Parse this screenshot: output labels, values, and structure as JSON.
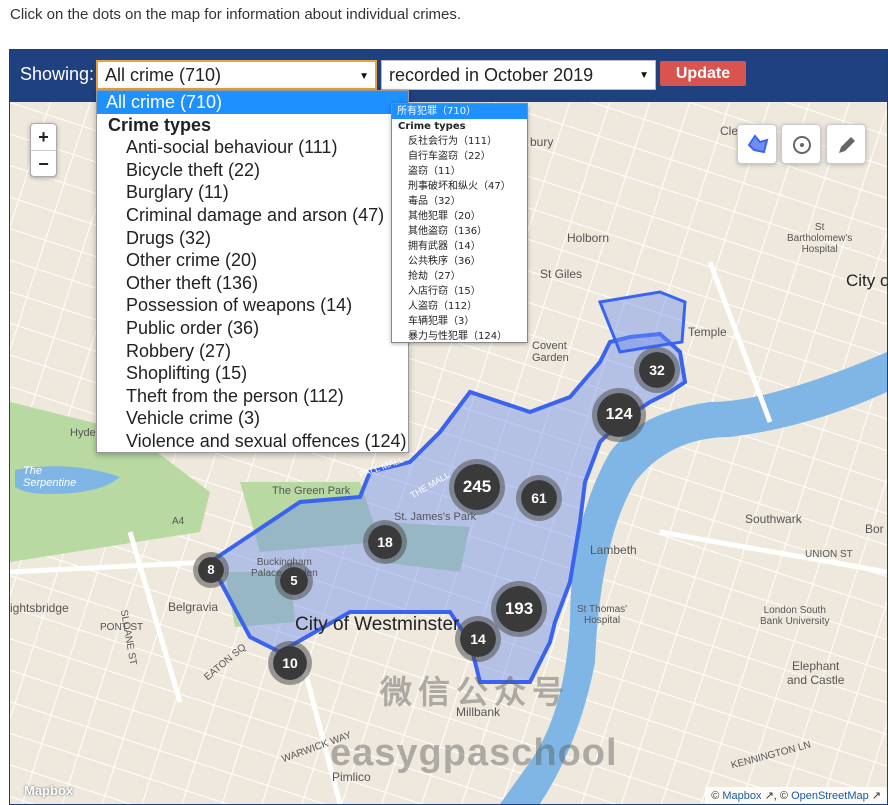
{
  "intro_text": "Click on the dots on the map for information about individual crimes.",
  "toolbar": {
    "showing_label": "Showing:",
    "crime_select_value": "All crime (710)",
    "period_select_value": "recorded in October 2019",
    "update_label": "Update"
  },
  "crime_dropdown": {
    "selected": "All crime (710)",
    "group_label": "Crime types",
    "options": [
      "Anti-social behaviour (111)",
      "Bicycle theft (22)",
      "Burglary (11)",
      "Criminal damage and arson (47)",
      "Drugs (32)",
      "Other crime (20)",
      "Other theft (136)",
      "Possession of weapons (14)",
      "Public order (36)",
      "Robbery (27)",
      "Shoplifting (15)",
      "Theft from the person (112)",
      "Vehicle crime (3)",
      "Violence and sexual offences (124)"
    ]
  },
  "crime_dropdown_zh": {
    "selected": "所有犯罪（710）",
    "group_label": "Crime types",
    "options": [
      "反社会行为（111）",
      "自行车盗窃（22）",
      "盗窃（11）",
      "刑事破坏和纵火（47）",
      "毒品（32）",
      "其他犯罪（20）",
      "其他盗窃（136）",
      "拥有武器（14）",
      "公共秩序（36）",
      "抢劫（27）",
      "入店行窃（15）",
      "人盗窃（112）",
      "车辆犯罪（3）",
      "暴力与性犯罪（124）"
    ]
  },
  "map": {
    "zoom_in": "+",
    "zoom_out": "−",
    "tools": [
      "polygon-draw-icon",
      "circle-draw-icon",
      "pencil-edit-icon"
    ],
    "clusters": [
      "32",
      "124",
      "245",
      "61",
      "18",
      "8",
      "5",
      "193",
      "14",
      "10"
    ],
    "labels": {
      "city_of_westminster": "City of Westminster",
      "city_of_london": "City of",
      "the_serpentine": "The\nSerpentine",
      "the_green_park": "The Green Park",
      "st_james_park": "St. James's Park",
      "buckingham": "Buckingham\nPalace Garden",
      "belgravia": "Belgravia",
      "lambeth": "Lambeth",
      "southwark": "Southwark",
      "holborn": "Holborn",
      "st_giles": "St Giles",
      "covent_garden": "Covent\nGarden",
      "temple": "Temple",
      "st_thomas": "St Thomas'\nHospital",
      "elephant": "Elephant\nand Castle",
      "lsbu": "London South\nBank University",
      "millbank": "Millbank",
      "pimlico": "Pimlico",
      "knightsbridge": "ightsbridge",
      "hyde": "Hyde",
      "st_barts": "St\nBartholomew's\nHospital",
      "union_st": "UNION ST",
      "kennington": "KENNINGTON LN",
      "pall_mall": "PALL MALL",
      "the_mall": "THE MALL",
      "sloane_st": "SLOANE ST",
      "eaton_sq": "EATON SQ",
      "pont_st": "PONT ST",
      "warwick_way": "WARWICK WAY",
      "a4": "A4",
      "clerk": "Cle",
      "bury": "bury",
      "bor": "Bor"
    },
    "logo": "Mapbox",
    "attribution_prefix": "© ",
    "attribution_mapbox": "Mapbox",
    "attribution_mid": " ↗, © ",
    "attribution_osm": "OpenStreetMap",
    "attribution_suffix": " ↗"
  },
  "watermark": {
    "cn": "微信公众号",
    "en": "easygpaschool"
  },
  "colors": {
    "toolbar": "#1f4180",
    "update_button": "#d9534f",
    "select_highlight": "#1e90ff",
    "area_fill": "#6f8ef0",
    "area_stroke": "#3a63f0",
    "river": "#7fb6e6",
    "park": "#b9d9a2"
  }
}
